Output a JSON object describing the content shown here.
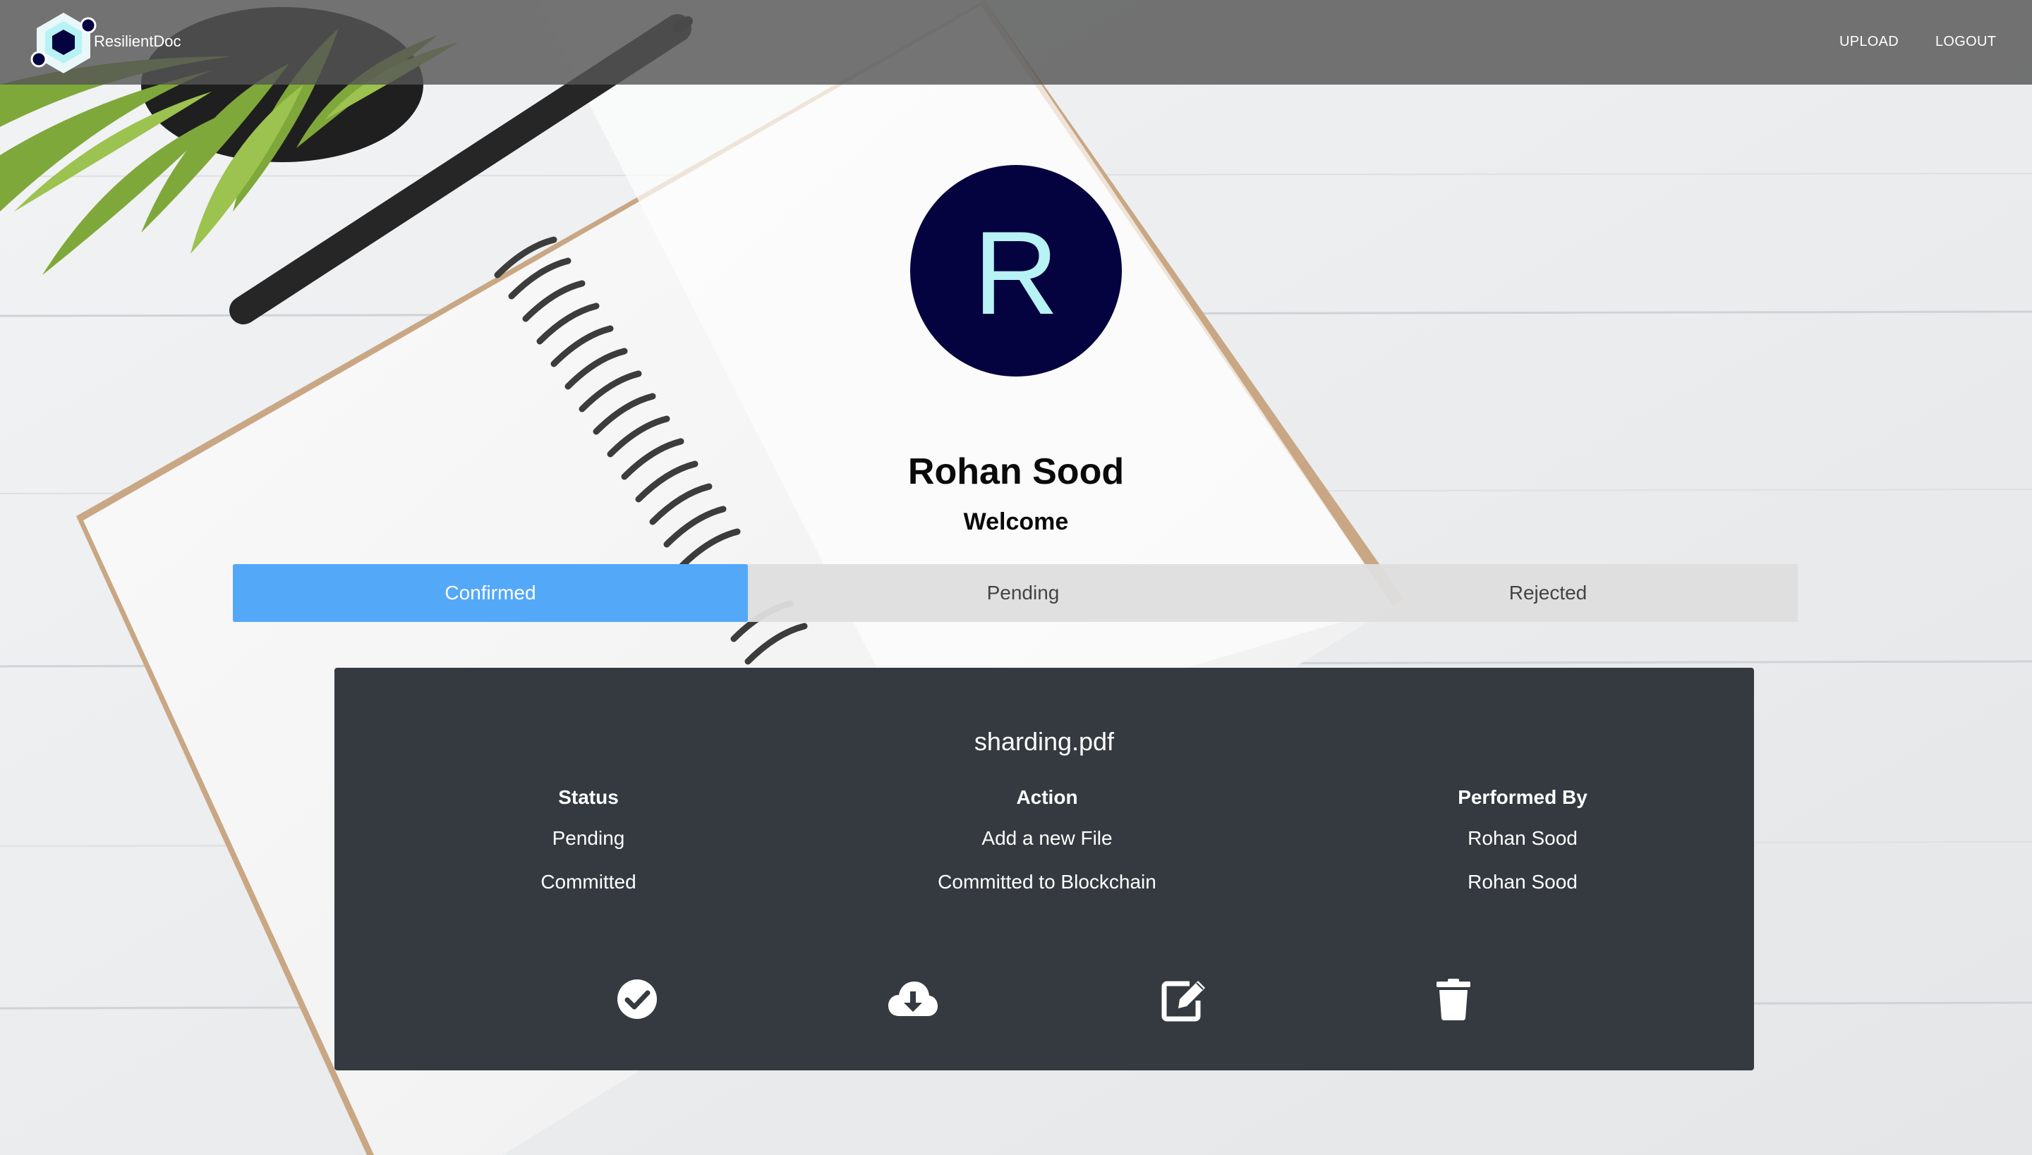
{
  "nav": {
    "brand": "ResilientDoc",
    "links": [
      "UPLOAD",
      "LOGOUT"
    ],
    "logo_icon": "hexagon-logo-icon"
  },
  "profile": {
    "initial": "R",
    "name": "Rohan Sood",
    "greeting": "Welcome",
    "avatar_bg": "#050240",
    "avatar_fg": "#b7f2f4"
  },
  "tabs": [
    {
      "label": "Confirmed",
      "active": true
    },
    {
      "label": "Pending",
      "active": false
    },
    {
      "label": "Rejected",
      "active": false
    }
  ],
  "colors": {
    "accent": "#54a8f8",
    "card_bg": "#343a40",
    "navbar": "#555555"
  },
  "file": {
    "name": "sharding.pdf",
    "headers": [
      "Status",
      "Action",
      "Performed By"
    ],
    "rows": [
      [
        "Pending",
        "Add a new File",
        "Rohan Sood"
      ],
      [
        "Committed",
        "Committed to Blockchain",
        "Rohan Sood"
      ]
    ],
    "actions": [
      "check-circle-icon",
      "cloud-download-icon",
      "edit-icon",
      "trash-icon"
    ]
  }
}
